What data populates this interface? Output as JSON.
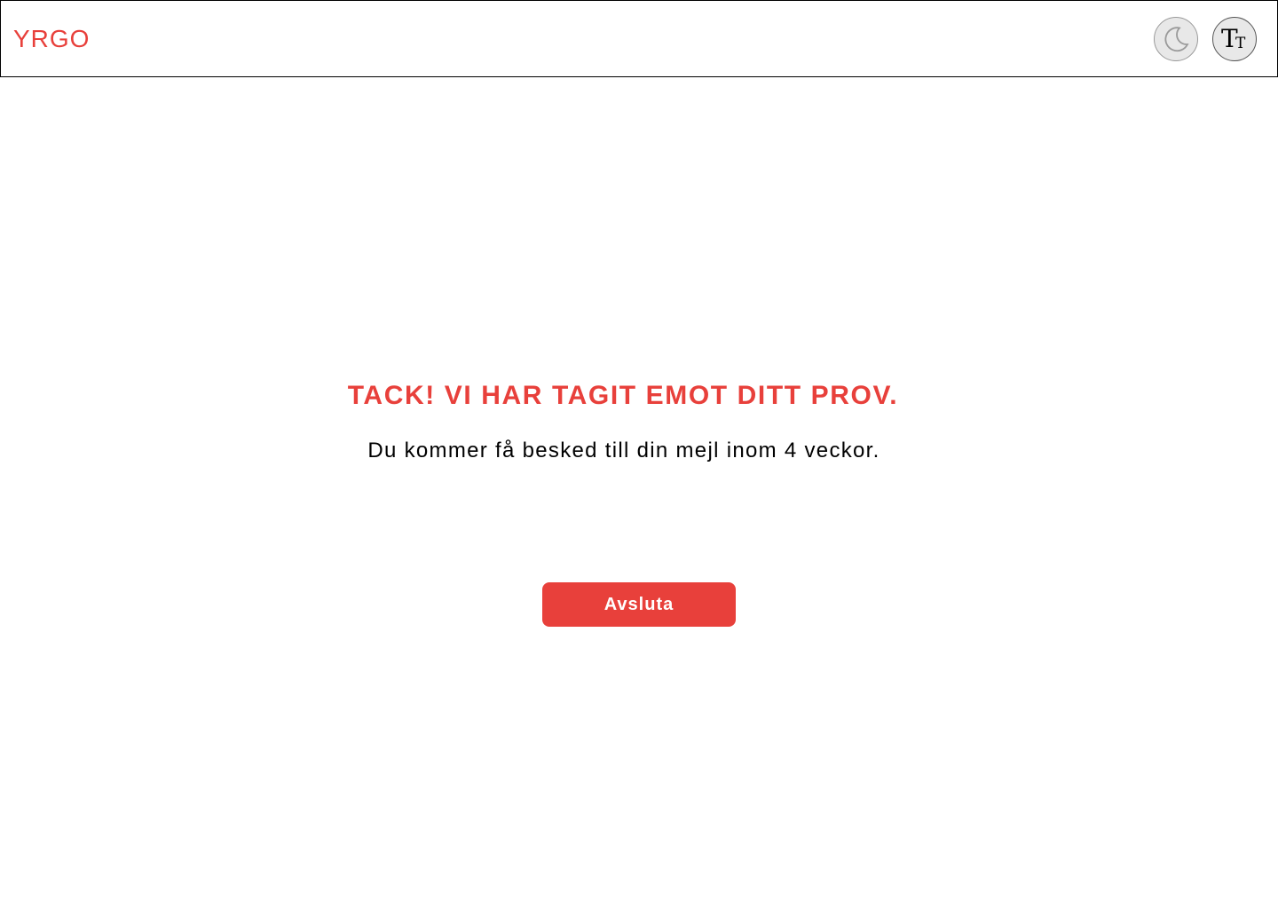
{
  "header": {
    "logo_text": "YRGO",
    "dark_mode_icon": "moon-icon",
    "text_size_icon": "text-size-icon"
  },
  "main": {
    "title": "TACK! VI HAR TAGIT EMOT DITT PROV.",
    "subtitle": "Du kommer få besked till din mejl inom 4 veckor.",
    "exit_button_label": "Avsluta"
  },
  "colors": {
    "brand": "#e8403b",
    "icon_button_bg": "#e8e8e8",
    "text": "#000000"
  }
}
